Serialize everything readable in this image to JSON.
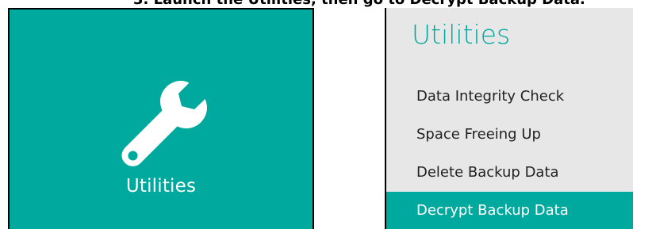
{
  "caption": "3.  Launch the Utilities, then go to Decrypt Backup Data.",
  "tile": {
    "label": "Utilities",
    "icon": "wrench-icon",
    "background": "#00a99d",
    "text_color": "#ffffff"
  },
  "menu": {
    "title": "Utilities",
    "title_color": "#00a99d",
    "background": "#e7e7e7",
    "items": [
      {
        "label": "Data Integrity Check",
        "active": false
      },
      {
        "label": "Space Freeing Up",
        "active": false
      },
      {
        "label": "Delete Backup Data",
        "active": false
      },
      {
        "label": "Decrypt Backup Data",
        "active": true
      }
    ],
    "active_color": "#00a99d"
  }
}
